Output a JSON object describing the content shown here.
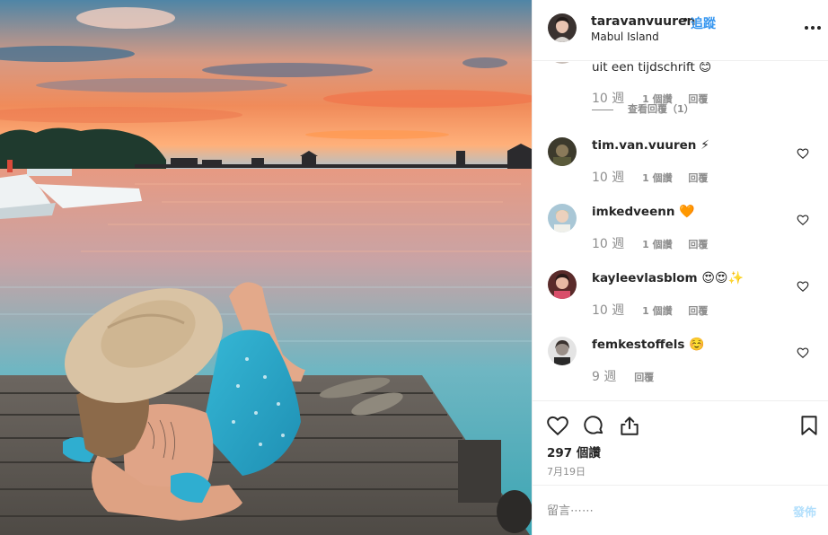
{
  "post": {
    "username": "taravanvuuren",
    "separator": "•",
    "follow_label": "追蹤",
    "location": "Mabul Island",
    "more_icon": "ellipsis-icon"
  },
  "partial_comment": {
    "text": "uit een tijdschrift 😊",
    "age": "10 週",
    "likes": "1 個讚",
    "reply": "回覆",
    "view_replies": "查看回覆（1）"
  },
  "comments": [
    {
      "user": "tim.van.vuuren",
      "emoji": "⚡",
      "age": "10 週",
      "likes": "1 個讚",
      "reply": "回覆"
    },
    {
      "user": "imkedveenn",
      "emoji": "🧡",
      "age": "10 週",
      "likes": "1 個讚",
      "reply": "回覆"
    },
    {
      "user": "kayleevlasblom",
      "emoji": "😍😍✨",
      "age": "10 週",
      "likes": "1 個讚",
      "reply": "回覆"
    },
    {
      "user": "femkestoffels",
      "emoji": "☺️",
      "age": "9 週",
      "likes": "",
      "reply": "回覆"
    }
  ],
  "actions": {
    "like_icon": "heart-icon",
    "comment_icon": "comment-icon",
    "share_icon": "share-icon",
    "save_icon": "bookmark-icon",
    "likes_count": "297 個讚",
    "date": "7月19日"
  },
  "add_comment": {
    "placeholder": "留言⋯⋯",
    "post_label": "發佈"
  },
  "colors": {
    "link_blue": "#3897f0",
    "post_disabled": "#b2dffc",
    "secondary_text": "#8e8e8e",
    "border": "#efefef"
  }
}
